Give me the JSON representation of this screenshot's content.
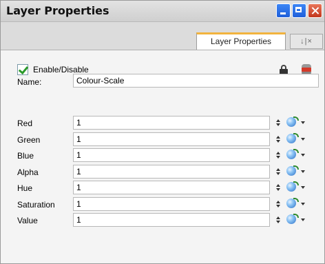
{
  "window": {
    "title": "Layer Properties"
  },
  "tabs": [
    {
      "label": "Layer Properties",
      "active": true
    }
  ],
  "tab_controls": "↓|×",
  "enable": {
    "label": "Enable/Disable",
    "checked": true
  },
  "name": {
    "label": "Name:",
    "value": "Colour-Scale"
  },
  "properties": [
    {
      "label": "Red",
      "value": "1"
    },
    {
      "label": "Green",
      "value": "1"
    },
    {
      "label": "Blue",
      "value": "1"
    },
    {
      "label": "Alpha",
      "value": "1"
    },
    {
      "label": "Hue",
      "value": "1"
    },
    {
      "label": "Saturation",
      "value": "1"
    },
    {
      "label": "Value",
      "value": "1"
    }
  ],
  "icons": {
    "lock": "lock-icon",
    "camera": "camera-icon",
    "stepper": "stepper-icon",
    "function": "function-curve-icon"
  },
  "colors": {
    "tab_accent": "#f2b33d",
    "check": "#2a9a2a",
    "close": "#c2361c",
    "titlebar_btn": "#1f5fd9"
  }
}
